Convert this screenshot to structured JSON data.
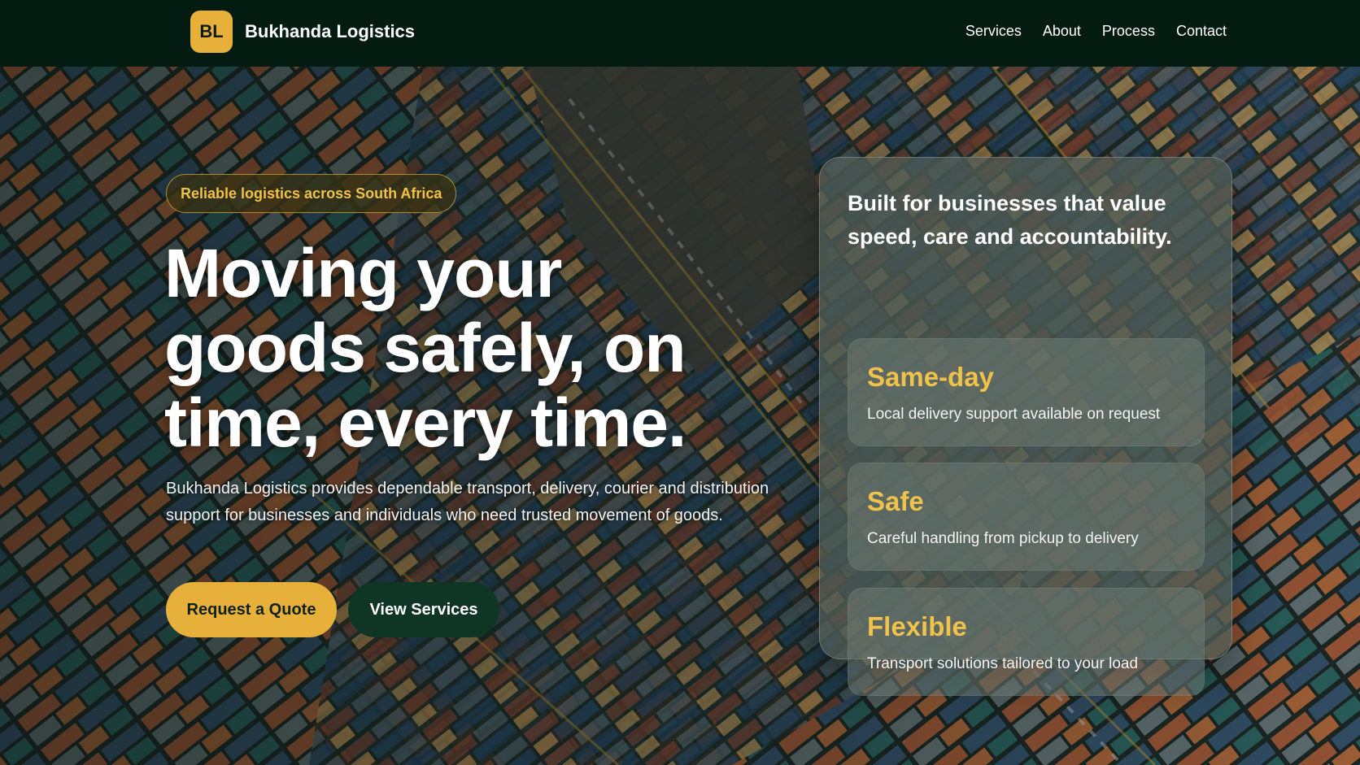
{
  "brand": {
    "logo_text": "BL",
    "name": "Bukhanda Logistics",
    "accent": "#e7b03a"
  },
  "nav": {
    "items": [
      "Services",
      "About",
      "Process",
      "Contact"
    ]
  },
  "hero": {
    "eyebrow": "Reliable logistics across South Africa",
    "headline": "Moving your goods safely, on time, every time.",
    "lede": "Bukhanda Logistics provides dependable transport, delivery, courier and distribution support for businesses and individuals who need trusted movement of goods.",
    "primary_cta": "Request a Quote",
    "secondary_cta": "View Services"
  },
  "panel": {
    "title": "Built for businesses that value speed, care and accountability.",
    "features": [
      {
        "title": "Same-day",
        "desc": "Local delivery support available on request"
      },
      {
        "title": "Safe",
        "desc": "Careful handling from pickup to delivery"
      },
      {
        "title": "Flexible",
        "desc": "Transport solutions tailored to your load"
      }
    ]
  }
}
